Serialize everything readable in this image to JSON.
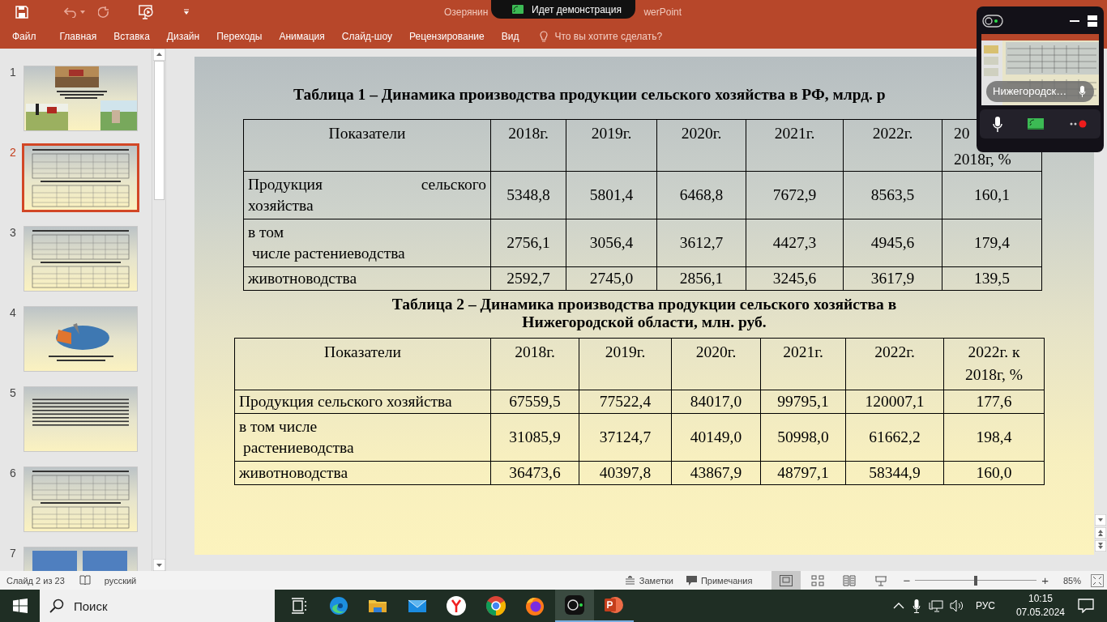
{
  "title_bar": {
    "title_left": "Озерянин",
    "title_right": "werPoint",
    "banner": "Идет демонстрация"
  },
  "ribbon_tabs": [
    "Файл",
    "Главная",
    "Вставка",
    "Дизайн",
    "Переходы",
    "Анимация",
    "Слайд-шоу",
    "Рецензирование",
    "Вид"
  ],
  "tell_me": {
    "placeholder": "Что вы хотите сделать?"
  },
  "thumbnails": [
    {
      "number": "1",
      "selected": false,
      "kind": "photos"
    },
    {
      "number": "2",
      "selected": true,
      "kind": "tables"
    },
    {
      "number": "3",
      "selected": false,
      "kind": "tables"
    },
    {
      "number": "4",
      "selected": false,
      "kind": "pie"
    },
    {
      "number": "5",
      "selected": false,
      "kind": "text"
    },
    {
      "number": "6",
      "selected": false,
      "kind": "tables"
    },
    {
      "number": "7",
      "selected": false,
      "kind": "boxes"
    }
  ],
  "tables": [
    {
      "title": [
        "Таблица 1 – Динамика производства продукции сельского хозяйства в РФ, млрд. р"
      ],
      "columns": [
        [
          "Показатели"
        ],
        [
          "2018г."
        ],
        [
          "2019г."
        ],
        [
          "2020г."
        ],
        [
          "2021г."
        ],
        [
          "2022г."
        ],
        [
          "20",
          "2018г, %"
        ]
      ],
      "rows": [
        {
          "label": [
            "Продукция сельского",
            "хозяйства"
          ],
          "justified": true,
          "values": [
            "5348,8",
            "5801,4",
            "6468,8",
            "7672,9",
            "8563,5",
            "160,1"
          ]
        },
        {
          "label": [
            "в том",
            " числе растениеводства"
          ],
          "justified": false,
          "values": [
            "2756,1",
            "3056,4",
            "3612,7",
            "4427,3",
            "4945,6",
            "179,4"
          ]
        },
        {
          "label": [
            "животноводства"
          ],
          "values": [
            "2592,7",
            "2745,0",
            "2856,1",
            "3245,6",
            "3617,9",
            "139,5"
          ]
        }
      ]
    },
    {
      "title": [
        "Таблица 2 – Динамика производства продукции сельского хозяйства в",
        "Нижегородской области, млн. руб."
      ],
      "columns": [
        [
          "Показатели"
        ],
        [
          "2018г."
        ],
        [
          "2019г."
        ],
        [
          "2020г."
        ],
        [
          "2021г."
        ],
        [
          "2022г."
        ],
        [
          "2022г. к",
          "2018г, %"
        ]
      ],
      "rows": [
        {
          "label": [
            "Продукция сельского хозяйства"
          ],
          "values": [
            "67559,5",
            "77522,4",
            "84017,0",
            "99795,1",
            "120007,1",
            "177,6"
          ]
        },
        {
          "label": [
            "в том числе",
            " растениеводства"
          ],
          "justified": false,
          "values": [
            "31085,9",
            "37124,7",
            "40149,0",
            "50998,0",
            "61662,2",
            "198,4"
          ]
        },
        {
          "label": [
            "животноводства"
          ],
          "values": [
            "36473,6",
            "40397,8",
            "43867,9",
            "48797,1",
            "58344,9",
            "160,0"
          ]
        }
      ]
    }
  ],
  "call_panel": {
    "participant": "Нижегородск…"
  },
  "status_bar": {
    "slide": "Слайд 2 из 23",
    "language": "русский",
    "notes": "Заметки",
    "comments": "Примечания",
    "views": [
      {
        "kind": "normal",
        "selected": true
      },
      {
        "kind": "sorter",
        "selected": false
      },
      {
        "kind": "reading",
        "selected": false
      },
      {
        "kind": "show",
        "selected": false
      }
    ],
    "zoom": {
      "level": 0.5,
      "reading": "85%",
      "zoom_out": "−",
      "zoom_in": "+"
    }
  },
  "taskbar": {
    "search": {
      "placeholder": "Поиск"
    },
    "apps": [
      {
        "kind": "taskview",
        "active": false,
        "running": false
      },
      {
        "kind": "edge",
        "active": false,
        "running": false
      },
      {
        "kind": "folder",
        "active": false,
        "running": false
      },
      {
        "kind": "mail",
        "active": false,
        "running": false
      },
      {
        "kind": "yandex",
        "active": false,
        "running": false
      },
      {
        "kind": "chrome",
        "active": false,
        "running": false
      },
      {
        "kind": "firefox",
        "active": false,
        "running": false
      },
      {
        "kind": "recorder",
        "active": true,
        "running": true
      },
      {
        "kind": "powerpoint",
        "active": false,
        "running": true
      }
    ],
    "language": "РУС",
    "time": "10:15",
    "date": "07.05.2024"
  }
}
